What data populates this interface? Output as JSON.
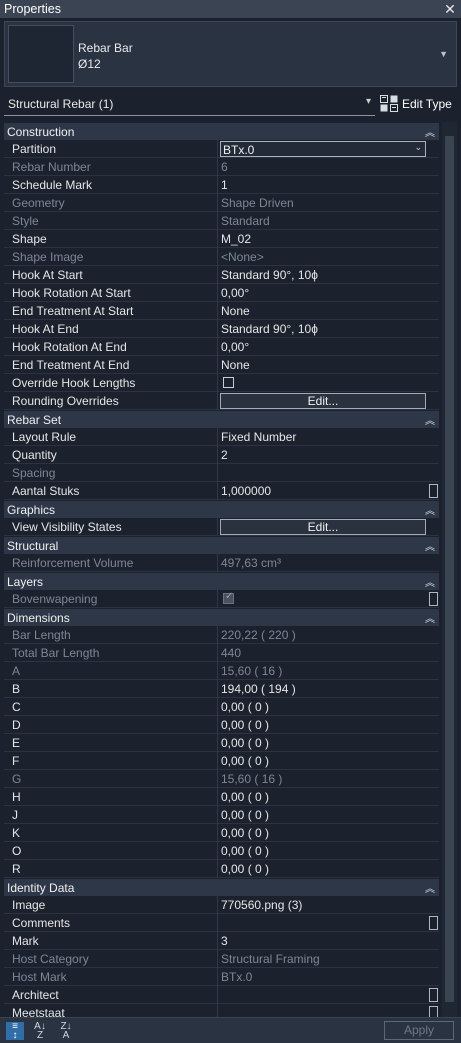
{
  "panel": {
    "title": "Properties"
  },
  "type_selector": {
    "family": "Rebar Bar",
    "type": "Ø12"
  },
  "instance_filter": {
    "label": "Structural Rebar (1)",
    "edit_type_label": "Edit Type"
  },
  "sections": [
    {
      "name": "Construction",
      "rows": [
        {
          "label": "Partition",
          "value": "BTx.0",
          "kind": "dropdown"
        },
        {
          "label": "Rebar Number",
          "value": "6",
          "readonly": true
        },
        {
          "label": "Schedule Mark",
          "value": "1"
        },
        {
          "label": "Geometry",
          "value": "Shape Driven",
          "readonly": true
        },
        {
          "label": "Style",
          "value": "Standard",
          "readonly": true
        },
        {
          "label": "Shape",
          "value": "M_02"
        },
        {
          "label": "Shape Image",
          "value": "<None>",
          "readonly": true
        },
        {
          "label": "Hook At Start",
          "value": "Standard 90°, 10ϕ"
        },
        {
          "label": "Hook Rotation At Start",
          "value": "0,00°"
        },
        {
          "label": "End Treatment At Start",
          "value": "None"
        },
        {
          "label": "Hook At End",
          "value": "Standard 90°, 10ϕ"
        },
        {
          "label": "Hook Rotation At End",
          "value": "0,00°"
        },
        {
          "label": "End Treatment At End",
          "value": "None"
        },
        {
          "label": "Override Hook Lengths",
          "value": "",
          "kind": "checkbox",
          "checked": false
        },
        {
          "label": "Rounding Overrides",
          "value": "Edit...",
          "kind": "button"
        }
      ]
    },
    {
      "name": "Rebar Set",
      "rows": [
        {
          "label": "Layout Rule",
          "value": "Fixed Number"
        },
        {
          "label": "Quantity",
          "value": "2"
        },
        {
          "label": "Spacing",
          "value": "",
          "readonly": true
        },
        {
          "label": "Aantal Stuks",
          "value": "1,000000",
          "mini": true
        }
      ]
    },
    {
      "name": "Graphics",
      "rows": [
        {
          "label": "View Visibility States",
          "value": "Edit...",
          "kind": "button"
        }
      ]
    },
    {
      "name": "Structural",
      "rows": [
        {
          "label": "Reinforcement Volume",
          "value": "497,63 cm³",
          "readonly": true
        }
      ]
    },
    {
      "name": "Layers",
      "rows": [
        {
          "label": "Bovenwapening",
          "value": "",
          "kind": "checkbox",
          "checked": true,
          "readonly": true,
          "mini": true
        }
      ]
    },
    {
      "name": "Dimensions",
      "rows": [
        {
          "label": "Bar Length",
          "value": "220,22 ( 220 )",
          "readonly": true
        },
        {
          "label": "Total Bar Length",
          "value": "440",
          "readonly": true
        },
        {
          "label": "A",
          "value": "15,60 ( 16 )",
          "readonly": true
        },
        {
          "label": "B",
          "value": "194,00 ( 194 )"
        },
        {
          "label": "C",
          "value": "0,00 ( 0 )"
        },
        {
          "label": "D",
          "value": "0,00 ( 0 )"
        },
        {
          "label": "E",
          "value": "0,00 ( 0 )"
        },
        {
          "label": "F",
          "value": "0,00 ( 0 )"
        },
        {
          "label": "G",
          "value": "15,60 ( 16 )",
          "readonly": true
        },
        {
          "label": "H",
          "value": "0,00 ( 0 )"
        },
        {
          "label": "J",
          "value": "0,00 ( 0 )"
        },
        {
          "label": "K",
          "value": "0,00 ( 0 )"
        },
        {
          "label": "O",
          "value": "0,00 ( 0 )"
        },
        {
          "label": "R",
          "value": "0,00 ( 0 )"
        }
      ]
    },
    {
      "name": "Identity Data",
      "rows": [
        {
          "label": "Image",
          "value": "770560.png (3)"
        },
        {
          "label": "Comments",
          "value": "",
          "mini": true
        },
        {
          "label": "Mark",
          "value": "3"
        },
        {
          "label": "Host Category",
          "value": "Structural Framing",
          "readonly": true
        },
        {
          "label": "Host Mark",
          "value": "BTx.0",
          "readonly": true
        },
        {
          "label": "Architect",
          "value": "",
          "mini": true
        },
        {
          "label": "Meetstaat",
          "value": "",
          "mini": true
        }
      ]
    }
  ],
  "footer": {
    "apply_label": "Apply"
  },
  "colors": {
    "background": "#1b222d",
    "section": "#2e3747",
    "readonly_text": "#7e8794",
    "accent": "#2f6ea8"
  }
}
